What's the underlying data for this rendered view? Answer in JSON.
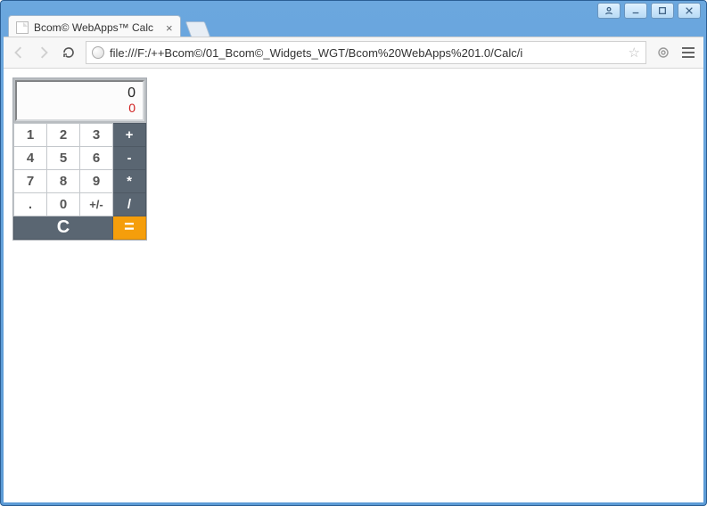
{
  "window": {
    "tab_title": "Bcom© WebApps™ Calc",
    "url": "file:///F:/++Bcom©/01_Bcom©_Widgets_WGT/Bcom%20WebApps%201.0/Calc/i"
  },
  "calculator": {
    "display_main": "0",
    "display_sub": "0",
    "keys": {
      "r0": [
        "1",
        "2",
        "3",
        "+"
      ],
      "r1": [
        "4",
        "5",
        "6",
        "-"
      ],
      "r2": [
        "7",
        "8",
        "9",
        "*"
      ],
      "r3": [
        ".",
        "0",
        "+/-",
        "/"
      ],
      "clear": "C",
      "equals": "="
    }
  },
  "colors": {
    "operator_bg": "#5A6672",
    "equals_bg": "#F59E0B",
    "sub_display": "#d02020"
  }
}
